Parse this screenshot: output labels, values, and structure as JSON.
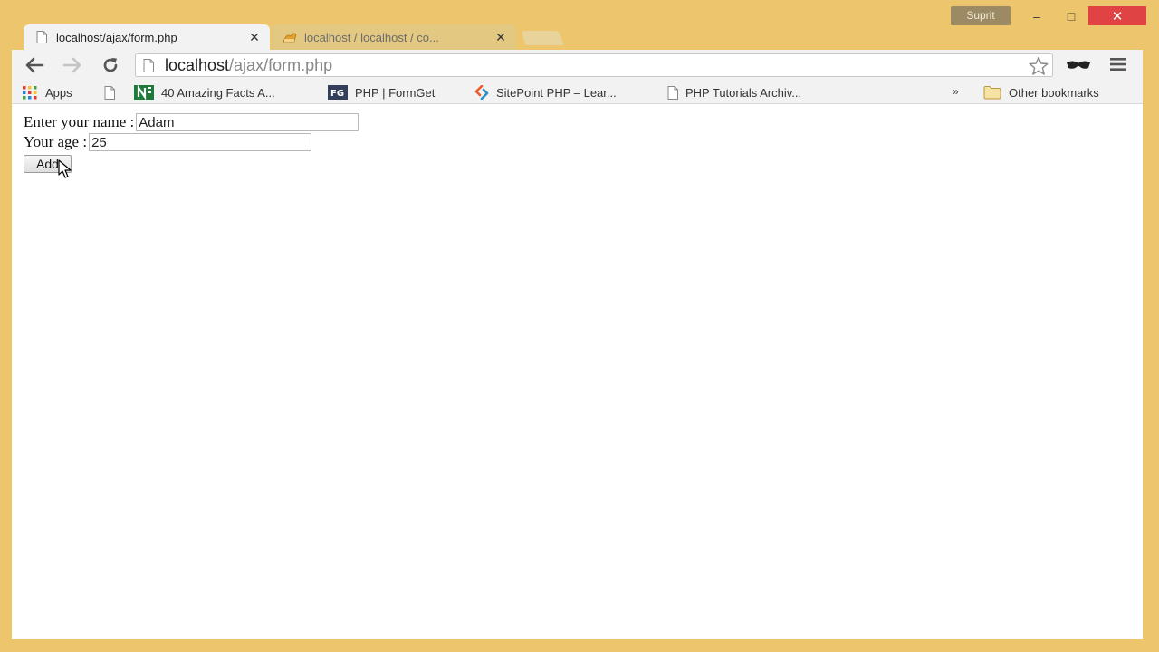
{
  "titlebar": {
    "user_name": "Suprit",
    "minimize": "–",
    "maximize": "□",
    "close": "✕"
  },
  "tabs": [
    {
      "title": "localhost/ajax/form.php",
      "active": true,
      "close": "✕"
    },
    {
      "title": "localhost / localhost / co...",
      "active": false,
      "close": "✕"
    }
  ],
  "omnibox": {
    "host": "localhost",
    "path": "/ajax/form.php"
  },
  "bookmarks": {
    "items": [
      {
        "label": "Apps",
        "icon": "apps-grid-icon"
      },
      {
        "label": "",
        "icon": "page-icon"
      },
      {
        "label": "40 Amazing Facts A...",
        "icon": "green-n-icon"
      },
      {
        "label": "PHP | FormGet",
        "icon": "formget-icon"
      },
      {
        "label": "SitePoint PHP – Lear...",
        "icon": "sitepoint-icon"
      },
      {
        "label": "PHP Tutorials Archiv...",
        "icon": "page-icon"
      }
    ],
    "more": "»",
    "other": "Other bookmarks"
  },
  "form": {
    "name_label": "Enter your name :",
    "name_value": "Adam",
    "age_label": "Your age :",
    "age_value": "25",
    "submit_label": "Add"
  },
  "colors": {
    "window_frame": "#ecc56c",
    "close_button": "#e04343",
    "chrome_toolbar": "#f2f2f2"
  }
}
